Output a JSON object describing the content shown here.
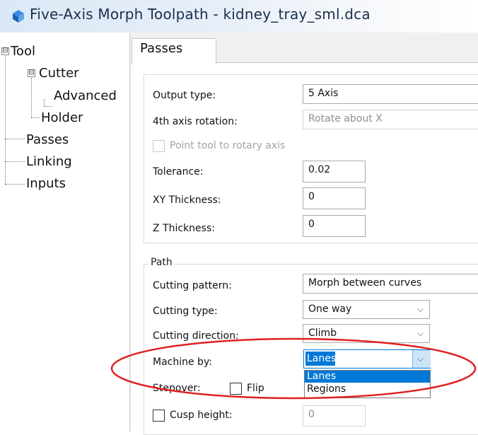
{
  "window": {
    "title": "Five-Axis Morph Toolpath - kidney_tray_sml.dca",
    "title_icon": "morph-toolpath-icon"
  },
  "tree": {
    "items": [
      {
        "label": "Tool",
        "expander": "⊟"
      },
      {
        "label": "Cutter",
        "expander": "⊟"
      },
      {
        "label": "Advanced"
      },
      {
        "label": "Holder"
      },
      {
        "label": "Passes"
      },
      {
        "label": "Linking"
      },
      {
        "label": "Inputs"
      }
    ]
  },
  "tab": {
    "label": "Passes"
  },
  "passes": {
    "output_type": {
      "label": "Output type:",
      "value": "5 Axis"
    },
    "fourth_axis": {
      "label": "4th axis rotation:",
      "value": "Rotate  about X"
    },
    "point_tool": {
      "label": "Point tool to rotary axis",
      "checked": false
    },
    "tolerance": {
      "label": "Tolerance:",
      "value": "0.02"
    },
    "xy_thickness": {
      "label": "XY Thickness:",
      "value": "0"
    },
    "z_thickness": {
      "label": "Z Thickness:",
      "value": "0"
    }
  },
  "path": {
    "group_label": "Path",
    "cutting_pattern": {
      "label": "Cutting pattern:",
      "value": "Morph between curves"
    },
    "cutting_type": {
      "label": "Cutting type:",
      "value": "One way"
    },
    "cutting_direction": {
      "label": "Cutting direction:",
      "value": "Climb"
    },
    "machine_by": {
      "label": "Machine by:",
      "value": "Lanes",
      "options": [
        "Lanes",
        "Regions"
      ],
      "highlighted": "Lanes"
    },
    "stepover": {
      "label": "Stepover:"
    },
    "flip": {
      "label": "Flip",
      "checked": false
    },
    "cusp_height": {
      "label": "Cusp height:",
      "value": "0",
      "checked": false
    }
  },
  "colors": {
    "selection": "#0078d7",
    "annotation": "#e02020",
    "title_gradient_start": "#dbe8f6"
  }
}
